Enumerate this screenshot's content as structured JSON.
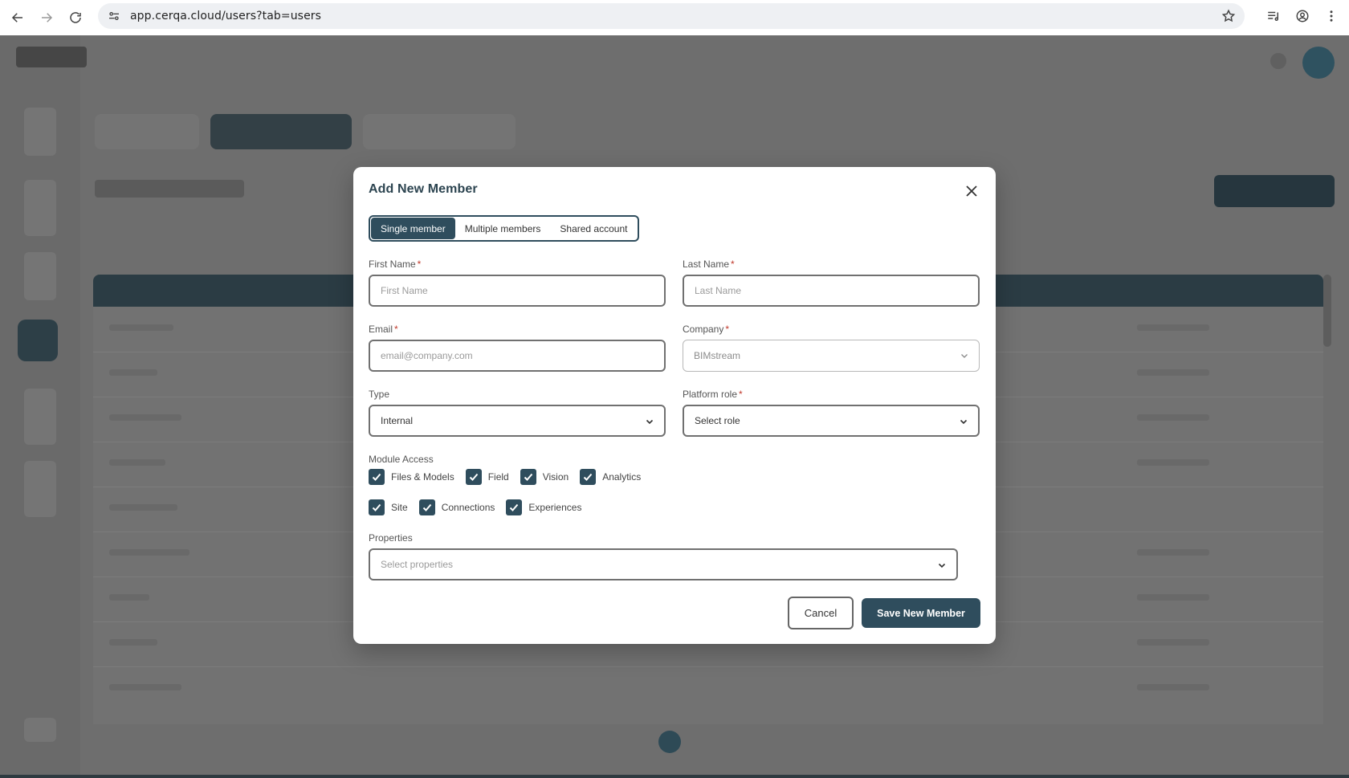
{
  "browser": {
    "url": "app.cerqa.cloud/users?tab=users"
  },
  "modal": {
    "title": "Add New Member",
    "tabs": [
      {
        "label": "Single member",
        "active": true
      },
      {
        "label": "Multiple members",
        "active": false
      },
      {
        "label": "Shared account",
        "active": false
      }
    ],
    "fields": {
      "first_name": {
        "label": "First Name",
        "placeholder": "First Name",
        "required": "*"
      },
      "last_name": {
        "label": "Last Name",
        "placeholder": "Last Name",
        "required": "*"
      },
      "email": {
        "label": "Email",
        "placeholder": "email@company.com",
        "required": "*"
      },
      "company": {
        "label": "Company",
        "value": "BIMstream",
        "required": "*"
      },
      "type": {
        "label": "Type",
        "value": "Internal"
      },
      "platform_role": {
        "label": "Platform role",
        "value": "Select role",
        "required": "*"
      },
      "properties": {
        "label": "Properties",
        "placeholder": "Select properties"
      }
    },
    "module_access": {
      "label": "Module Access",
      "row1": [
        {
          "label": "Files & Models",
          "checked": true
        },
        {
          "label": "Field",
          "checked": true
        },
        {
          "label": "Vision",
          "checked": true
        },
        {
          "label": "Analytics",
          "checked": true
        }
      ],
      "row2": [
        {
          "label": "Site",
          "checked": true
        },
        {
          "label": "Connections",
          "checked": true
        },
        {
          "label": "Experiences",
          "checked": true
        }
      ]
    },
    "buttons": {
      "cancel": "Cancel",
      "save": "Save New Member"
    }
  },
  "colors": {
    "accent": "#2f4d5d",
    "required": "#c0392b",
    "overlay": "#6e6e6e"
  }
}
